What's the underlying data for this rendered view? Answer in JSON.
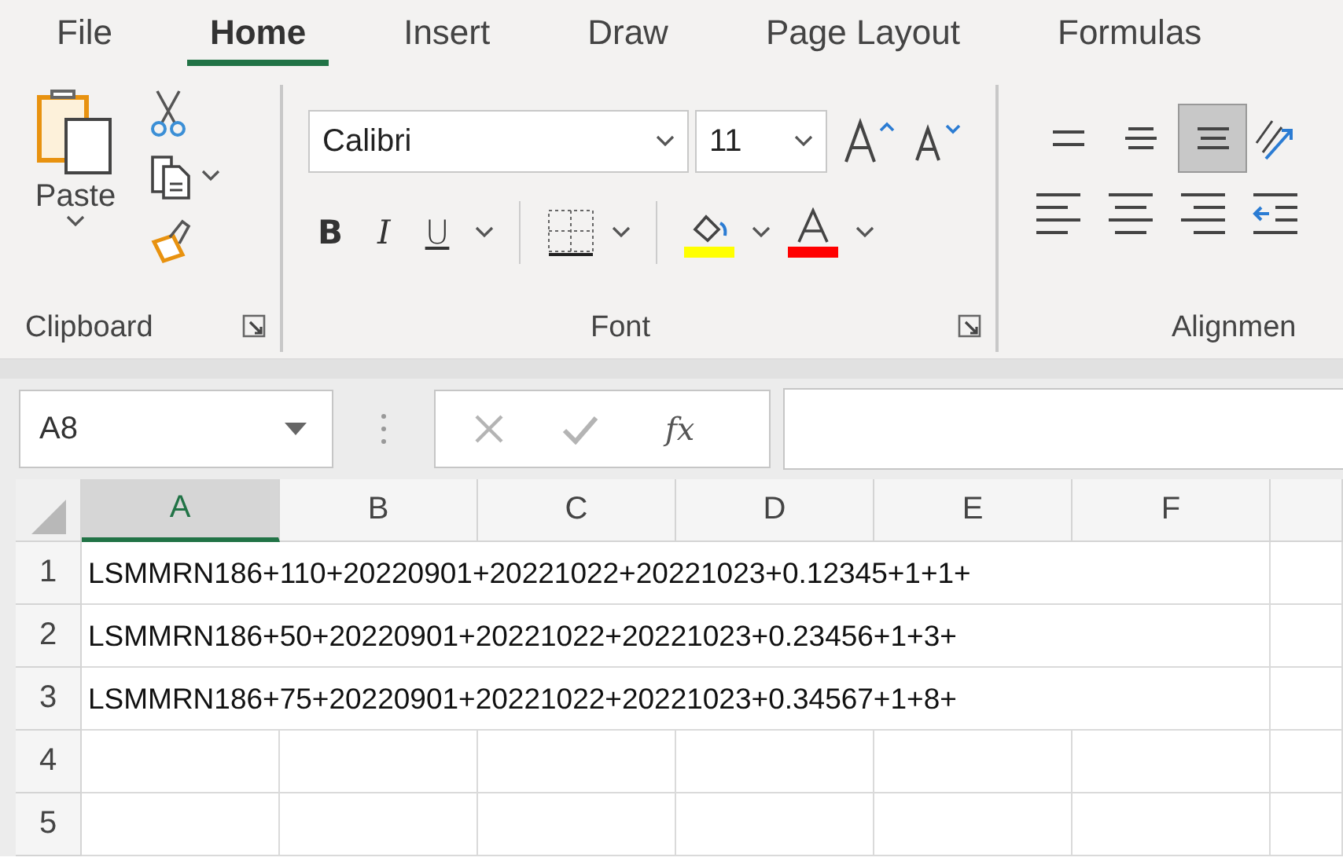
{
  "tabs": [
    {
      "label": "File",
      "selected": false
    },
    {
      "label": "Home",
      "selected": true
    },
    {
      "label": "Insert",
      "selected": false
    },
    {
      "label": "Draw",
      "selected": false
    },
    {
      "label": "Page Layout",
      "selected": false
    },
    {
      "label": "Formulas",
      "selected": false
    }
  ],
  "ribbon": {
    "clipboard": {
      "paste_label": "Paste",
      "group_label": "Clipboard"
    },
    "font": {
      "font_name": "Calibri",
      "font_size": "11",
      "bold_label": "B",
      "italic_label": "I",
      "underline_label": "U",
      "group_label": "Font"
    },
    "alignment": {
      "vertical": [
        {
          "kind": "top",
          "selected": false
        },
        {
          "kind": "middle",
          "selected": false
        },
        {
          "kind": "bottom",
          "selected": true
        }
      ],
      "group_label": "Alignmen"
    }
  },
  "formula_bar": {
    "name_box": "A8",
    "function_label": "fx"
  },
  "sheet": {
    "columns": [
      {
        "label": "A",
        "selected": true
      },
      {
        "label": "B",
        "selected": false
      },
      {
        "label": "C",
        "selected": false
      },
      {
        "label": "D",
        "selected": false
      },
      {
        "label": "E",
        "selected": false
      },
      {
        "label": "F",
        "selected": false
      }
    ],
    "rows": [
      {
        "header": "1",
        "text": "LSMMRN186+110+20220901+20221022+20221023+0.12345+1+1+"
      },
      {
        "header": "2",
        "text": "LSMMRN186+50+20220901+20221022+20221023+0.23456+1+3+"
      },
      {
        "header": "3",
        "text": "LSMMRN186+75+20220901+20221022+20221023+0.34567+1+8+"
      },
      {
        "header": "4"
      },
      {
        "header": "5"
      }
    ]
  }
}
